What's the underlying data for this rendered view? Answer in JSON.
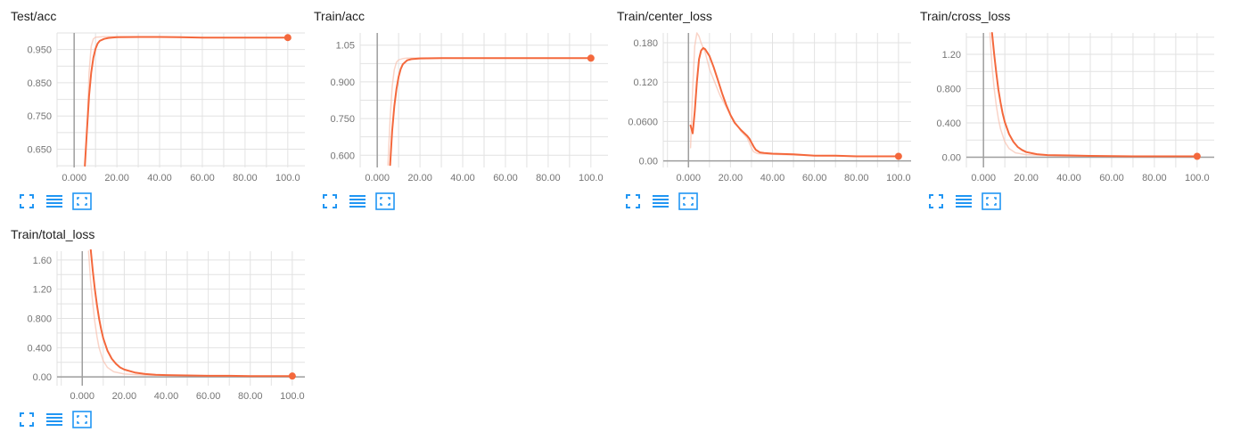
{
  "colors": {
    "accent": "#f4683c",
    "ghost": "#f8c2b0",
    "grid": "#e2e2e2",
    "axis": "#9e9e9e",
    "tick_text": "#757575",
    "button": "#2196f3"
  },
  "controls": {
    "expand_icon": "expand-icon",
    "data_icon": "lines-icon",
    "fit_icon": "fit-domain-icon"
  },
  "chart_data": [
    {
      "type": "line",
      "title": "Test/acc",
      "xlim": [
        -8,
        108
      ],
      "ylim": [
        0.595,
        1.0
      ],
      "xticks": [
        0,
        20,
        40,
        60,
        80,
        100
      ],
      "xtick_labels": [
        "0.000",
        "20.00",
        "40.00",
        "60.00",
        "80.00",
        "100.0"
      ],
      "yticks": [
        0.65,
        0.75,
        0.85,
        0.95
      ],
      "ytick_labels": [
        "0.650",
        "0.750",
        "0.850",
        "0.950"
      ],
      "series": [
        {
          "role": "smoothed",
          "x": [
            5,
            6,
            7,
            8,
            9,
            10,
            11,
            12,
            14,
            16,
            20,
            30,
            40,
            50,
            60,
            70,
            80,
            90,
            100
          ],
          "y": [
            0.6,
            0.71,
            0.81,
            0.88,
            0.925,
            0.952,
            0.968,
            0.976,
            0.982,
            0.985,
            0.987,
            0.988,
            0.988,
            0.987,
            0.986,
            0.986,
            0.986,
            0.986,
            0.986
          ]
        },
        {
          "role": "raw",
          "x": [
            6,
            7,
            8,
            9,
            10,
            12,
            14,
            20,
            40,
            60,
            80,
            100
          ],
          "y": [
            0.7,
            0.88,
            0.96,
            0.982,
            0.987,
            0.988,
            0.989,
            0.989,
            0.988,
            0.986,
            0.986,
            0.986
          ]
        }
      ]
    },
    {
      "type": "line",
      "title": "Train/acc",
      "xlim": [
        -8,
        108
      ],
      "ylim": [
        0.55,
        1.1
      ],
      "xticks": [
        0,
        20,
        40,
        60,
        80,
        100
      ],
      "xtick_labels": [
        "0.000",
        "20.00",
        "40.00",
        "60.00",
        "80.00",
        "100.0"
      ],
      "yticks": [
        0.6,
        0.75,
        0.9,
        1.05
      ],
      "ytick_labels": [
        "0.600",
        "0.750",
        "0.900",
        "1.05"
      ],
      "series": [
        {
          "role": "smoothed",
          "x": [
            6,
            7,
            8,
            9,
            10,
            11,
            12,
            14,
            16,
            20,
            30,
            40,
            60,
            80,
            100
          ],
          "y": [
            0.56,
            0.7,
            0.8,
            0.87,
            0.92,
            0.953,
            0.972,
            0.988,
            0.993,
            0.996,
            0.997,
            0.997,
            0.997,
            0.997,
            0.997
          ]
        },
        {
          "role": "raw",
          "x": [
            5,
            6,
            7,
            8,
            9,
            10,
            12,
            14,
            20,
            40,
            60,
            80,
            100
          ],
          "y": [
            0.56,
            0.75,
            0.88,
            0.95,
            0.98,
            0.99,
            0.995,
            0.997,
            0.998,
            0.997,
            0.997,
            0.997,
            0.997
          ]
        }
      ]
    },
    {
      "type": "line",
      "title": "Train/center_loss",
      "xlim": [
        -12,
        106
      ],
      "ylim": [
        -0.01,
        0.195
      ],
      "xticks": [
        0,
        20,
        40,
        60,
        80,
        100
      ],
      "xtick_labels": [
        "0.000",
        "20.00",
        "40.00",
        "60.00",
        "80.00",
        "100.0"
      ],
      "yticks": [
        0,
        0.06,
        0.12,
        0.18
      ],
      "ytick_labels": [
        "0.00",
        "0.0600",
        "0.120",
        "0.180"
      ],
      "series": [
        {
          "role": "smoothed",
          "x": [
            1,
            2,
            3,
            4,
            5,
            6,
            7,
            8,
            10,
            12,
            14,
            16,
            18,
            20,
            22,
            25,
            28,
            29,
            30,
            31,
            32,
            34,
            36,
            40,
            50,
            60,
            70,
            80,
            90,
            100
          ],
          "y": [
            0.054,
            0.042,
            0.075,
            0.12,
            0.155,
            0.168,
            0.172,
            0.17,
            0.16,
            0.143,
            0.123,
            0.103,
            0.085,
            0.07,
            0.058,
            0.047,
            0.038,
            0.034,
            0.028,
            0.022,
            0.017,
            0.013,
            0.012,
            0.011,
            0.01,
            0.008,
            0.008,
            0.007,
            0.007,
            0.007
          ]
        },
        {
          "role": "raw",
          "x": [
            1,
            2,
            3,
            4,
            5,
            6,
            8,
            10,
            15,
            20,
            25,
            28,
            30,
            31,
            33,
            40,
            60,
            80,
            100
          ],
          "y": [
            0.02,
            0.11,
            0.175,
            0.195,
            0.19,
            0.18,
            0.165,
            0.14,
            0.1,
            0.07,
            0.045,
            0.035,
            0.02,
            0.014,
            0.011,
            0.01,
            0.008,
            0.007,
            0.007
          ]
        }
      ]
    },
    {
      "type": "line",
      "title": "Train/cross_loss",
      "xlim": [
        -8,
        108
      ],
      "ylim": [
        -0.12,
        1.45
      ],
      "xticks": [
        0,
        20,
        40,
        60,
        80,
        100
      ],
      "xtick_labels": [
        "0.000",
        "20.00",
        "40.00",
        "60.00",
        "80.00",
        "100.0"
      ],
      "yticks": [
        0,
        0.4,
        0.8,
        1.2
      ],
      "ytick_labels": [
        "0.00",
        "0.400",
        "0.800",
        "1.20"
      ],
      "series": [
        {
          "role": "smoothed",
          "x": [
            4,
            5,
            6,
            7,
            8,
            9,
            10,
            12,
            14,
            16,
            18,
            20,
            25,
            30,
            40,
            50,
            60,
            70,
            80,
            90,
            100
          ],
          "y": [
            1.45,
            1.2,
            0.98,
            0.79,
            0.64,
            0.51,
            0.41,
            0.27,
            0.18,
            0.12,
            0.085,
            0.06,
            0.035,
            0.025,
            0.02,
            0.015,
            0.012,
            0.01,
            0.01,
            0.01,
            0.01
          ]
        },
        {
          "role": "raw",
          "x": [
            3,
            4,
            5,
            6,
            7,
            8,
            10,
            12,
            15,
            20,
            30,
            40,
            60,
            80,
            100
          ],
          "y": [
            1.45,
            1.05,
            0.8,
            0.6,
            0.45,
            0.33,
            0.18,
            0.1,
            0.05,
            0.03,
            0.02,
            0.015,
            0.012,
            0.01,
            0.01
          ]
        }
      ]
    },
    {
      "type": "line",
      "title": "Train/total_loss",
      "xlim": [
        -12,
        106
      ],
      "ylim": [
        -0.12,
        1.72
      ],
      "xticks": [
        0,
        20,
        40,
        60,
        80,
        100
      ],
      "xtick_labels": [
        "0.000",
        "20.00",
        "40.00",
        "60.00",
        "80.00",
        "100.0"
      ],
      "yticks": [
        0,
        0.4,
        0.8,
        1.2,
        1.6
      ],
      "ytick_labels": [
        "0.00",
        "0.400",
        "0.800",
        "1.20",
        "1.60"
      ],
      "series": [
        {
          "role": "smoothed",
          "x": [
            4,
            5,
            6,
            7,
            8,
            9,
            10,
            12,
            14,
            16,
            18,
            20,
            25,
            30,
            35,
            40,
            50,
            60,
            70,
            80,
            90,
            100
          ],
          "y": [
            1.75,
            1.45,
            1.2,
            0.98,
            0.8,
            0.65,
            0.53,
            0.36,
            0.25,
            0.18,
            0.13,
            0.1,
            0.06,
            0.04,
            0.03,
            0.025,
            0.02,
            0.015,
            0.015,
            0.012,
            0.012,
            0.012
          ]
        },
        {
          "role": "raw",
          "x": [
            3,
            4,
            5,
            6,
            7,
            8,
            10,
            12,
            15,
            20,
            30,
            40,
            60,
            80,
            100
          ],
          "y": [
            1.72,
            1.3,
            1.0,
            0.75,
            0.55,
            0.4,
            0.22,
            0.13,
            0.07,
            0.04,
            0.025,
            0.02,
            0.015,
            0.012,
            0.012
          ]
        }
      ]
    }
  ]
}
